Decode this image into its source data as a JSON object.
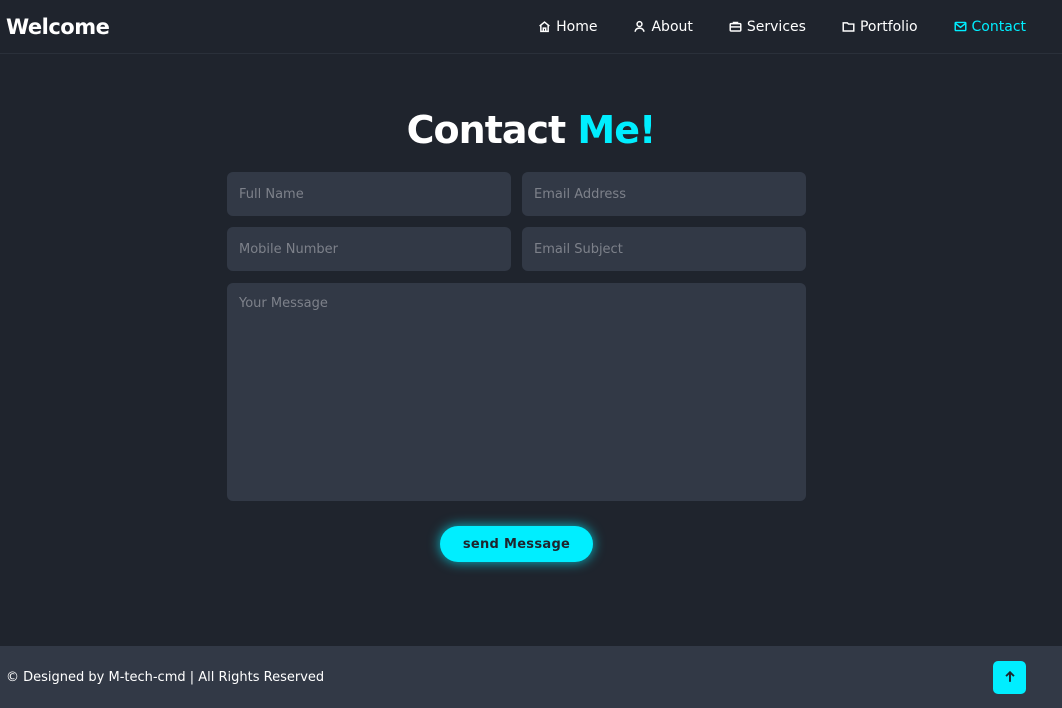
{
  "header": {
    "logo": "Welcome",
    "nav": [
      {
        "label": "Home",
        "icon": "home-icon"
      },
      {
        "label": "About",
        "icon": "user-icon"
      },
      {
        "label": "Services",
        "icon": "briefcase-icon"
      },
      {
        "label": "Portfolio",
        "icon": "folder-icon"
      },
      {
        "label": "Contact",
        "icon": "mail-icon",
        "active": true
      }
    ]
  },
  "contact": {
    "heading_main": "Contact",
    "heading_accent": "Me!",
    "fields": {
      "full_name": {
        "placeholder": "Full Name",
        "value": ""
      },
      "email": {
        "placeholder": "Email Address",
        "value": ""
      },
      "mobile": {
        "placeholder": "Mobile Number",
        "value": ""
      },
      "subject": {
        "placeholder": "Email Subject",
        "value": ""
      },
      "message": {
        "placeholder": "Your Message",
        "value": ""
      }
    },
    "send_label": "send Message"
  },
  "footer": {
    "text": "© Designed by M-tech-cmd | All Rights Reserved",
    "scroll_top_icon": "arrow-up-icon"
  },
  "colors": {
    "background": "#1f242d",
    "secondary_bg": "#323946",
    "accent": "#00eeff",
    "text": "#ffffff"
  }
}
